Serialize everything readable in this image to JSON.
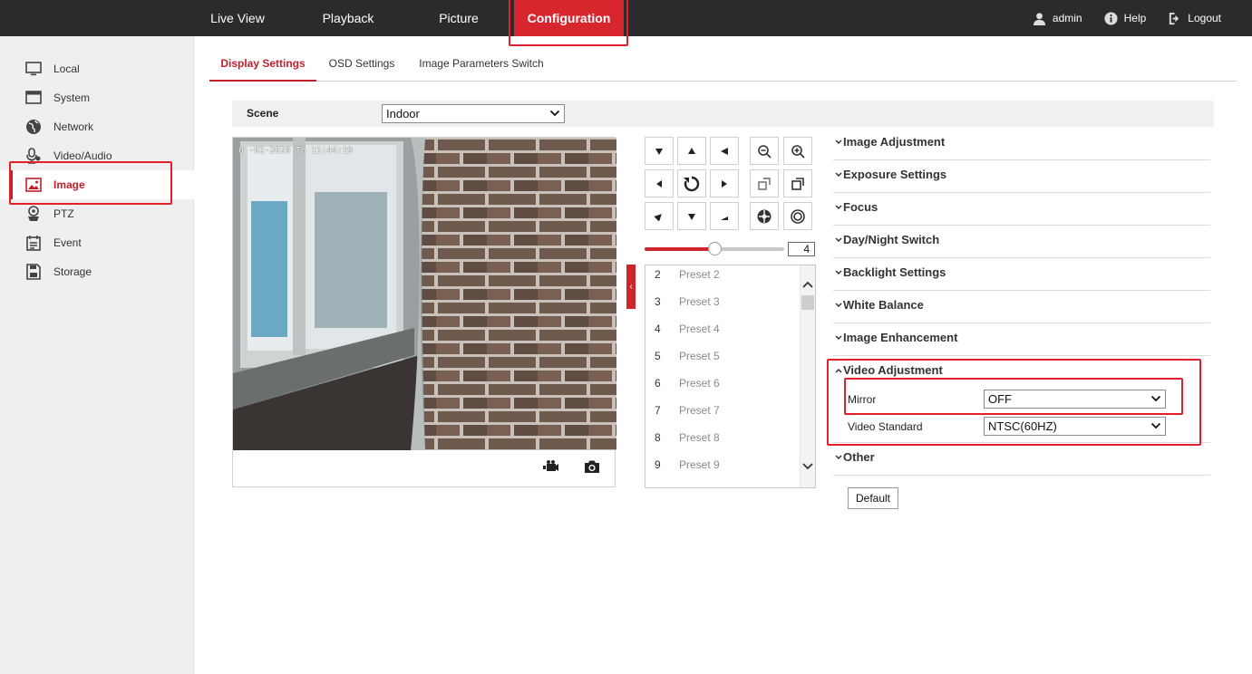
{
  "topbar": {
    "nav": [
      {
        "label": "Live View",
        "active": false
      },
      {
        "label": "Playback",
        "active": false
      },
      {
        "label": "Picture",
        "active": false
      },
      {
        "label": "Configuration",
        "active": true
      }
    ],
    "user": {
      "label": "admin",
      "icon": "user-icon"
    },
    "help": {
      "label": "Help",
      "icon": "help-icon"
    },
    "logout": {
      "label": "Logout",
      "icon": "logout-icon"
    }
  },
  "sidebar": {
    "items": [
      {
        "label": "Local",
        "icon": "monitor-icon",
        "active": false
      },
      {
        "label": "System",
        "icon": "system-window-icon",
        "active": false
      },
      {
        "label": "Network",
        "icon": "globe-icon",
        "active": false
      },
      {
        "label": "Video/Audio",
        "icon": "microphone-icon",
        "active": false
      },
      {
        "label": "Image",
        "icon": "image-icon",
        "active": true
      },
      {
        "label": "PTZ",
        "icon": "ptz-camera-icon",
        "active": false
      },
      {
        "label": "Event",
        "icon": "event-calendar-icon",
        "active": false
      },
      {
        "label": "Storage",
        "icon": "storage-disk-icon",
        "active": false
      }
    ]
  },
  "tabs": [
    {
      "label": "Display Settings",
      "active": true
    },
    {
      "label": "OSD Settings",
      "active": false
    },
    {
      "label": "Image Parameters Switch",
      "active": false
    }
  ],
  "scene": {
    "label": "Scene",
    "value": "Indoor"
  },
  "preview": {
    "osd_time": "0 -02-2020 Th  11:44:19",
    "record_icon": "video-record-icon",
    "capture_icon": "camera-capture-icon"
  },
  "ptz": {
    "speed": {
      "value": 4,
      "min": 1,
      "max": 7,
      "display": "4"
    },
    "presets": [
      {
        "num": "2",
        "name": "Preset 2"
      },
      {
        "num": "3",
        "name": "Preset 3"
      },
      {
        "num": "4",
        "name": "Preset 4"
      },
      {
        "num": "5",
        "name": "Preset 5"
      },
      {
        "num": "6",
        "name": "Preset 6"
      },
      {
        "num": "7",
        "name": "Preset 7"
      },
      {
        "num": "8",
        "name": "Preset 8"
      },
      {
        "num": "9",
        "name": "Preset 9"
      }
    ]
  },
  "accordion": {
    "sections": [
      {
        "label": "Image Adjustment",
        "expanded": false
      },
      {
        "label": "Exposure Settings",
        "expanded": false
      },
      {
        "label": "Focus",
        "expanded": false
      },
      {
        "label": "Day/Night Switch",
        "expanded": false
      },
      {
        "label": "Backlight Settings",
        "expanded": false
      },
      {
        "label": "White Balance",
        "expanded": false
      },
      {
        "label": "Image Enhancement",
        "expanded": false
      },
      {
        "label": "Video Adjustment",
        "expanded": true
      },
      {
        "label": "Other",
        "expanded": false
      }
    ],
    "video_adjustment": {
      "mirror": {
        "label": "Mirror",
        "value": "OFF"
      },
      "video_standard": {
        "label": "Video Standard",
        "value": "NTSC(60HZ)"
      }
    }
  },
  "default_button": "Default",
  "colors": {
    "accent": "#d8262f",
    "topbar": "#2b2b2b",
    "sidebar": "#efefef"
  }
}
